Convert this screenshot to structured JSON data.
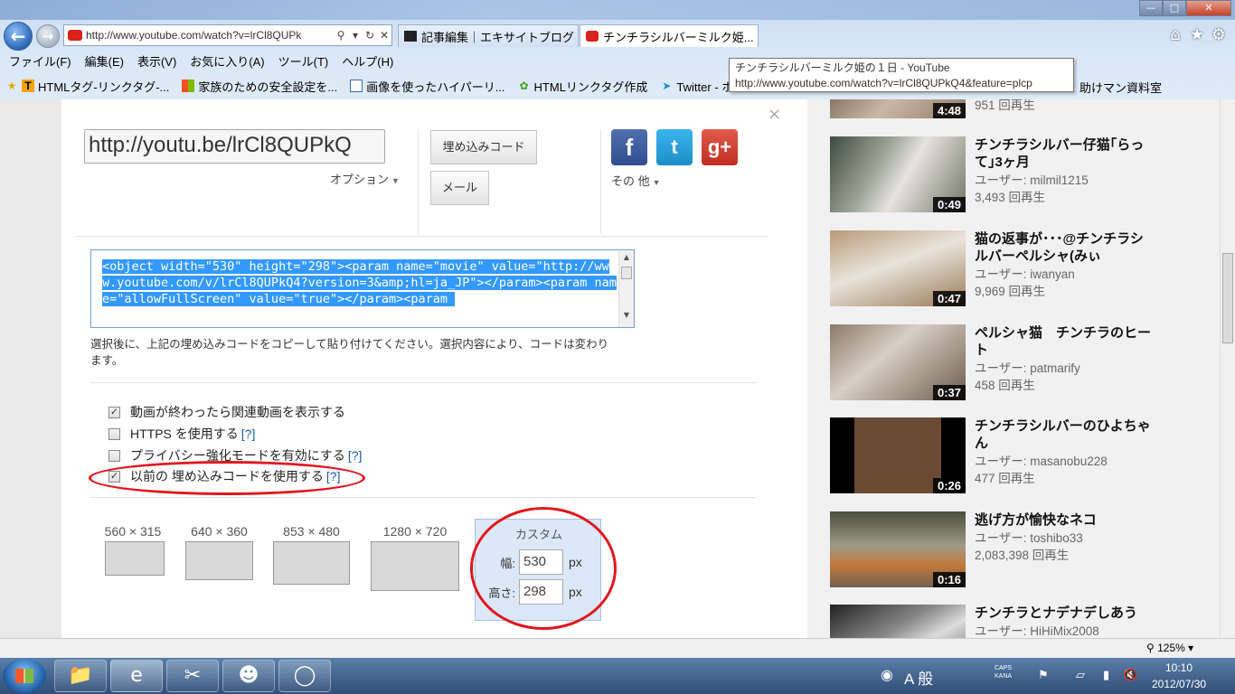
{
  "browser": {
    "address": "http://www.youtube.com/watch?v=lrCl8QUPk",
    "tabs": [
      {
        "label": "記事編集｜エキサイトブログ"
      },
      {
        "label": "チンチラシルバーミルク姫..."
      }
    ],
    "menu": [
      "ファイル(F)",
      "編集(E)",
      "表示(V)",
      "お気に入り(A)",
      "ツール(T)",
      "ヘルプ(H)"
    ],
    "favorites": [
      {
        "label": "HTMLタグ-リンクタグ-...",
        "icon": "T"
      },
      {
        "label": "家族のための安全設定を...",
        "icon": "windows-logo-icon"
      },
      {
        "label": "画像を使ったハイパーリ...",
        "icon": "page-icon"
      },
      {
        "label": "HTMLリンクタグ作成",
        "icon": "plant-icon"
      },
      {
        "label": "Twitter - ホーム",
        "icon": "twitter-bird-icon"
      }
    ],
    "favorites_overflow": "助けマン資料室",
    "tooltip": {
      "title": "チンチラシルバーミルク姫の１日 - YouTube",
      "url": "http://www.youtube.com/watch?v=lrCl8QUPkQ4&feature=plcp"
    },
    "zoom": "125%"
  },
  "share": {
    "short_url": "http://youtu.be/lrCl8QUPkQ",
    "options_label": "オプション",
    "embed_button": "埋め込みコード",
    "email_button": "メール",
    "more_label": "その 他",
    "social": {
      "facebook": "f",
      "twitter": "t",
      "googleplus": "g+"
    },
    "embed_code": "<object width=\"530\" height=\"298\"><param name=\"movie\" value=\"http://www.youtube.com/v/lrCl8QUPkQ4?version=3&amp;hl=ja_JP\"></param><param name=\"allowFullScreen\" value=\"true\"></param><param ",
    "embed_hint": "選択後に、上記の埋め込みコードをコピーして貼り付けてください。選択内容により、コードは変わります。",
    "options": [
      {
        "label": "動画が終わったら関連動画を表示する",
        "checked": true,
        "help": ""
      },
      {
        "label": "HTTPS を使用する",
        "checked": false,
        "help": "[?]"
      },
      {
        "label": "プライバシー強化モードを有効にする",
        "checked": false,
        "help": "[?]"
      },
      {
        "label": "以前の 埋め込みコードを使用する",
        "checked": true,
        "help": "[?]"
      }
    ],
    "sizes": [
      "560 × 315",
      "640 × 360",
      "853 × 480",
      "1280 × 720"
    ],
    "custom": {
      "title": "カスタム",
      "width_label": "幅:",
      "width": "530",
      "height_label": "高さ:",
      "height": "298",
      "unit": "px"
    }
  },
  "related": [
    {
      "title": "",
      "duration": "4:48",
      "user": "",
      "views": "951 回再生"
    },
    {
      "title": "チンチラシルバー仔猫｢らって｣3ヶ月",
      "duration": "0:49",
      "user": "ユーザー: milmil1215",
      "views": "3,493 回再生"
    },
    {
      "title": "猫の返事が･･･@チンチラシルバーペルシャ(みぃ",
      "duration": "0:47",
      "user": "ユーザー: iwanyan",
      "views": "9,969 回再生"
    },
    {
      "title": "ペルシャ猫　チンチラのヒート",
      "duration": "0:37",
      "user": "ユーザー: patmarify",
      "views": "458 回再生"
    },
    {
      "title": "チンチラシルバーのひよちゃん",
      "duration": "0:26",
      "user": "ユーザー: masanobu228",
      "views": "477 回再生"
    },
    {
      "title": "逃げ方が愉快なネコ",
      "duration": "0:16",
      "user": "ユーザー: toshibo33",
      "views": "2,083,398 回再生"
    },
    {
      "title": "チンチラとナデナデしあう",
      "duration": "",
      "user": "ユーザー: HiHiMix2008",
      "views": ""
    }
  ],
  "taskbar": {
    "ime_label": "A 般",
    "caps": "CAPS",
    "kana": "KANA",
    "time": "10:10",
    "date": "2012/07/30"
  }
}
